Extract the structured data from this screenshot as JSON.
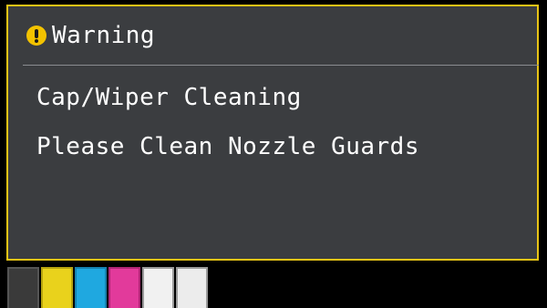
{
  "dialog": {
    "title": "Warning",
    "icon": "warning-exclamation-icon",
    "accent_color": "#e8c416",
    "lines": [
      "Cap/Wiper Cleaning",
      "Please Clean Nozzle Guards"
    ]
  },
  "ink_slots": [
    {
      "color": "black",
      "hex": "#3a3a3a"
    },
    {
      "color": "yellow",
      "hex": "#e9d21c"
    },
    {
      "color": "cyan",
      "hex": "#1fa8e0"
    },
    {
      "color": "magenta",
      "hex": "#e23a9b"
    },
    {
      "color": "white",
      "hex": "#f1f1f1"
    },
    {
      "color": "white",
      "hex": "#ececec"
    }
  ]
}
